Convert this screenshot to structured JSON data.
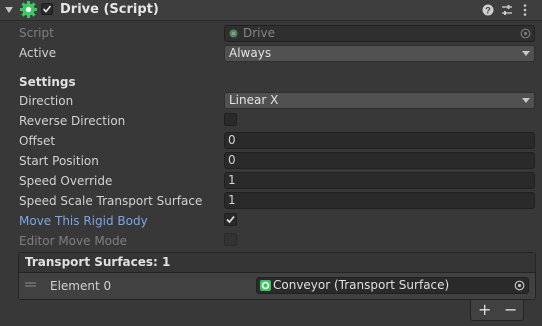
{
  "component": {
    "title": "Drive (Script)",
    "enabled": true
  },
  "fields": {
    "script_label": "Script",
    "script_value": "Drive",
    "active_label": "Active",
    "active_value": "Always",
    "settings_header": "Settings",
    "direction_label": "Direction",
    "direction_value": "Linear X",
    "reverse_label": "Reverse Direction",
    "reverse_checked": false,
    "offset_label": "Offset",
    "offset_value": "0",
    "start_label": "Start Position",
    "start_value": "0",
    "speed_override_label": "Speed Override",
    "speed_override_value": "1",
    "speed_scale_label": "Speed Scale Transport Surface",
    "speed_scale_value": "1",
    "move_rb_label": "Move This Rigid Body",
    "move_rb_checked": true,
    "editor_move_label": "Editor Move Mode",
    "editor_move_checked": false
  },
  "transport_surfaces": {
    "header": "Transport Surfaces: 1",
    "elements": [
      {
        "label": "Element 0",
        "value": "Conveyor (Transport Surface)"
      }
    ]
  },
  "footer": {
    "add": "+",
    "remove": "−"
  },
  "colors": {
    "highlight_label": "#7ba7e6",
    "component_icon": "#38c760"
  },
  "icons": [
    "foldout-arrow-icon",
    "component-gear-icon",
    "checkbox-checked-icon",
    "help-icon",
    "preset-icon",
    "menu-icon",
    "script-asset-icon",
    "object-picker-icon",
    "dropdown-caret-icon",
    "drag-handle-icon",
    "transport-surface-icon"
  ]
}
